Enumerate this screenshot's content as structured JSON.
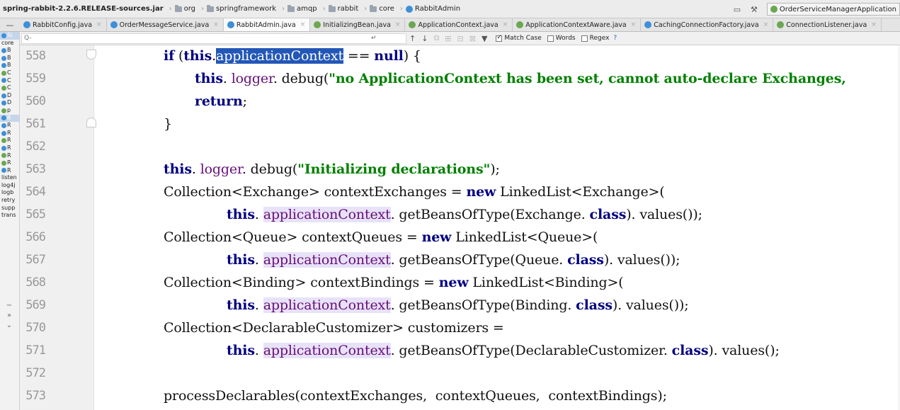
{
  "breadcrumb": {
    "items": [
      "spring-rabbit-2.2.6.RELEASE-sources.jar",
      "org",
      "springframework",
      "amqp",
      "rabbit",
      "core",
      "RabbitAdmin"
    ]
  },
  "toolbar": {
    "run_config": "OrderServiceManagerApplication"
  },
  "tabs": [
    {
      "label": "RabbitConfig.java",
      "icon": "class-icon",
      "active": false
    },
    {
      "label": "OrderMessageService.java",
      "icon": "class-icon",
      "active": false
    },
    {
      "label": "RabbitAdmin.java",
      "icon": "class-icon",
      "active": true
    },
    {
      "label": "InitializingBean.java",
      "icon": "interface-icon",
      "active": false
    },
    {
      "label": "ApplicationContext.java",
      "icon": "interface-icon",
      "active": false
    },
    {
      "label": "ApplicationContextAware.java",
      "icon": "interface-icon",
      "active": false
    },
    {
      "label": "CachingConnectionFactory.java",
      "icon": "class-icon",
      "active": false
    },
    {
      "label": "ConnectionListener.java",
      "icon": "interface-icon",
      "active": false
    }
  ],
  "project_tree": {
    "items": [
      "Si",
      "core",
      "B",
      "B",
      "B",
      "C",
      "C",
      "C",
      "D",
      "D",
      "p",
      "R",
      "R",
      "R",
      "R",
      "R",
      "R",
      "R",
      "R",
      "listen",
      "log4j",
      "logb",
      "retry",
      "supp",
      "trans"
    ]
  },
  "search": {
    "value": "",
    "placeholder": "Q-",
    "match_case_label": "Match Case",
    "match_case_checked": true,
    "words_label": "Words",
    "words_checked": false,
    "regex_label": "Regex",
    "help_label": "?"
  },
  "editor": {
    "line_numbers": [
      "558",
      "559",
      "560",
      "561",
      "562",
      "563",
      "564",
      "565",
      "566",
      "567",
      "568",
      "569",
      "570",
      "571",
      "572",
      "573"
    ],
    "code": {
      "l558": {
        "kw_if": "if",
        "p1": " (",
        "kw_this": "this",
        "p2": ".",
        "selected": "applicationContext",
        "p3": " == ",
        "kw_null": "null",
        "p4": ") {"
      },
      "l559": {
        "kw_this": "this",
        "p1": ". ",
        "field": "logger",
        "p2": ". debug(",
        "str": "\"no ApplicationContext has been set, cannot auto-declare Exchanges,"
      },
      "l560": {
        "kw_return": "return",
        "p1": ";"
      },
      "l561": {
        "p1": "}"
      },
      "l563": {
        "kw_this": "this",
        "p1": ". ",
        "field": "logger",
        "p2": ". debug(",
        "str": "\"Initializing declarations\"",
        "p3": ");"
      },
      "l564": {
        "p1": "Collection<Exchange> contextExchanges = ",
        "kw_new": "new",
        "p2": " LinkedList<Exchange>("
      },
      "l565": {
        "kw_this": "this",
        "p1": ". ",
        "field": "applicationContext",
        "p2": ". getBeansOfType(Exchange. ",
        "kw_class": "class",
        "p3": "). values());"
      },
      "l566": {
        "p1": "Collection<Queue> contextQueues = ",
        "kw_new": "new",
        "p2": " LinkedList<Queue>("
      },
      "l567": {
        "kw_this": "this",
        "p1": ". ",
        "field": "applicationContext",
        "p2": ". getBeansOfType(Queue. ",
        "kw_class": "class",
        "p3": "). values());"
      },
      "l568": {
        "p1": "Collection<Binding> contextBindings = ",
        "kw_new": "new",
        "p2": " LinkedList<Binding>("
      },
      "l569": {
        "kw_this": "this",
        "p1": ". ",
        "field": "applicationContext",
        "p2": ". getBeansOfType(Binding. ",
        "kw_class": "class",
        "p3": "). values());"
      },
      "l570": {
        "p1": "Collection<DeclarableCustomizer> customizers ="
      },
      "l571": {
        "kw_this": "this",
        "p1": ". ",
        "field": "applicationContext",
        "p2": ". getBeansOfType(DeclarableCustomizer. ",
        "kw_class": "class",
        "p3": "). values();"
      },
      "l573": {
        "p1": "processDeclarables(contextExchanges,  contextQueues,  contextBindings);"
      }
    }
  },
  "colors": {
    "keyword": "#000080",
    "string": "#008000",
    "field": "#660e7a",
    "selection": "#2357b7",
    "field_highlight": "#e8e2f8"
  }
}
